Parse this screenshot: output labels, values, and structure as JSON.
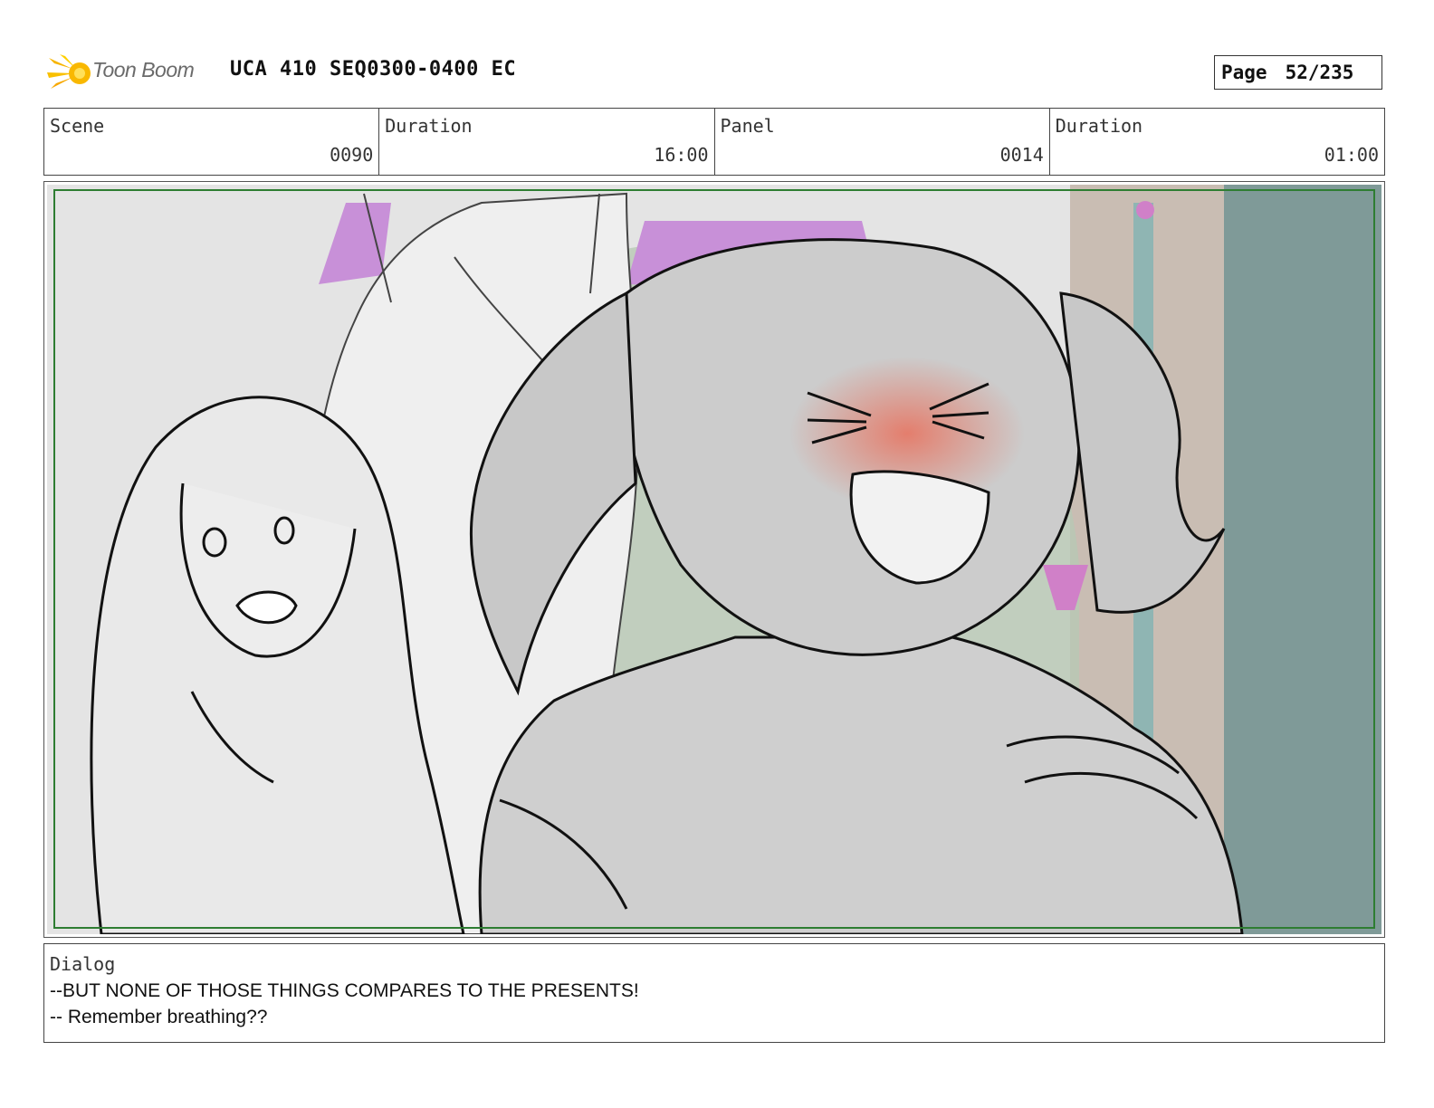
{
  "header": {
    "logo_text": "Toon Boom",
    "title": "UCA 410 SEQ0300-0400 EC",
    "page_label": "Page",
    "page_value": "52/235"
  },
  "info": {
    "scene_label": "Scene",
    "scene_value": "0090",
    "scene_duration_label": "Duration",
    "scene_duration_value": "16:00",
    "panel_label": "Panel",
    "panel_value": "0014",
    "panel_duration_label": "Duration",
    "panel_duration_value": "01:00"
  },
  "panel": {
    "frame_color": "#2e7d32"
  },
  "dialog": {
    "label": "Dialog",
    "lines": [
      "--BUT NONE OF THOSE THINGS COMPARES TO THE PRESENTS!",
      "-- Remember breathing??"
    ]
  }
}
